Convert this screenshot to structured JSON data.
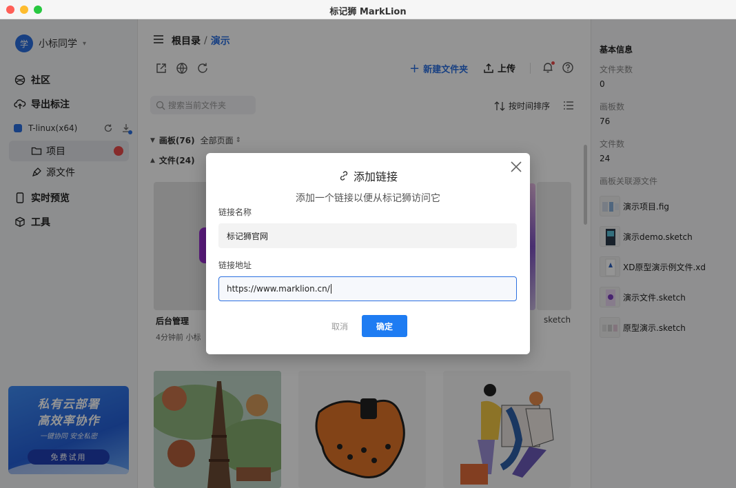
{
  "window": {
    "title": "标记狮 MarkLion"
  },
  "sidebar": {
    "user": {
      "avatar_text": "学",
      "name": "小标同学"
    },
    "nav": {
      "community": "社区",
      "export": "导出标注",
      "preview": "实时预览",
      "tools": "工具"
    },
    "workspace": {
      "name": "T-linux(x64)"
    },
    "sub": {
      "projects": "项目",
      "source": "源文件"
    },
    "promo": {
      "line1": "私有云部署",
      "line2": "高效率协作",
      "line3": "一键协同    安全私密",
      "cta": "免费试用"
    }
  },
  "main": {
    "breadcrumb": {
      "root": "根目录",
      "sep": "/",
      "current": "演示"
    },
    "toolbar": {
      "new_folder": "新建文件夹",
      "upload": "上传"
    },
    "search": {
      "placeholder": "搜索当前文件夹"
    },
    "sort": {
      "label": "按时间排序"
    },
    "sections": {
      "boards": {
        "label": "画板(76)",
        "filter": "全部页面"
      },
      "files": {
        "label": "文件(24)"
      }
    },
    "cards": {
      "card1": {
        "title": "后台管理",
        "meta": "4分钟前 小标"
      },
      "sketch_tag": "sketch"
    }
  },
  "info": {
    "heading": "基本信息",
    "folder_count_label": "文件夹数",
    "folder_count": "0",
    "board_count_label": "画板数",
    "board_count": "76",
    "file_count_label": "文件数",
    "file_count": "24",
    "linked_label": "画板关联源文件",
    "files": [
      {
        "name": "演示项目.fig"
      },
      {
        "name": "演示demo.sketch"
      },
      {
        "name": "XD原型演示例文件.xd"
      },
      {
        "name": "演示文件.sketch"
      },
      {
        "name": "原型演示.sketch"
      }
    ]
  },
  "modal": {
    "title": "添加链接",
    "subtitle": "添加一个链接以便从标记狮访问它",
    "name_label": "链接名称",
    "name_value": "标记狮官网",
    "url_label": "链接地址",
    "url_value": "https://www.marklion.cn/",
    "cancel": "取消",
    "confirm": "确定"
  },
  "colors": {
    "accent": "#2a6fe0",
    "primary_button": "#1e7cf2",
    "badge": "#e84b4b"
  }
}
